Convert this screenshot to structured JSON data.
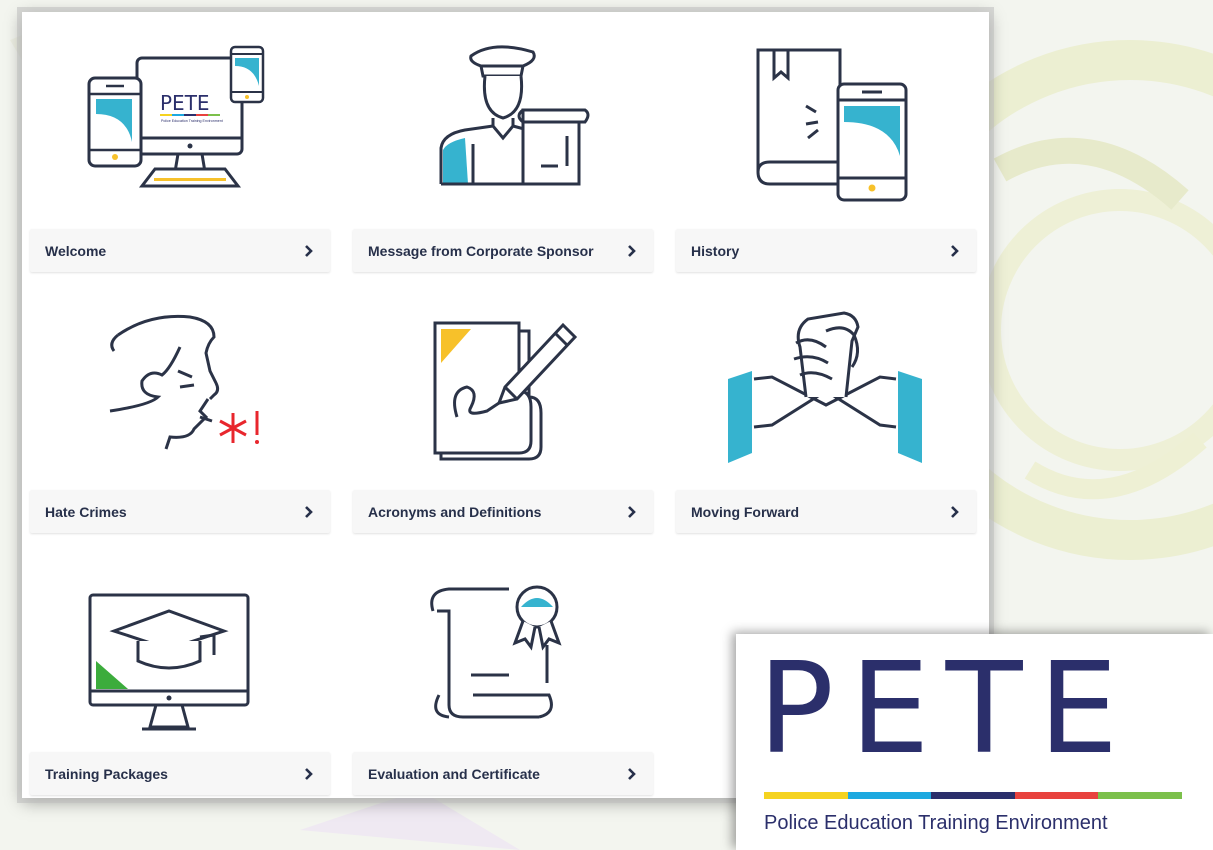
{
  "tiles": [
    {
      "label": "Welcome",
      "icon": "devices-pete-icon"
    },
    {
      "label": "Message from Corporate Sponsor",
      "icon": "officer-scroll-icon"
    },
    {
      "label": "History",
      "icon": "book-phone-icon"
    },
    {
      "label": "Hate Crimes",
      "icon": "shouting-face-icon"
    },
    {
      "label": "Acronyms and Definitions",
      "icon": "document-pencil-icon"
    },
    {
      "label": "Moving Forward",
      "icon": "handshake-icon"
    },
    {
      "label": "Training Packages",
      "icon": "monitor-graduation-cap-icon"
    },
    {
      "label": "Evaluation and Certificate",
      "icon": "certificate-scroll-icon"
    }
  ],
  "mini_logo": {
    "word": "PETE",
    "subtitle": "Police Education Training Environment"
  },
  "logo": {
    "word": "PETE",
    "subtitle": "Police Education Training Environment",
    "stripe_colors": [
      "#f5d320",
      "#1da9e0",
      "#2b2f6b",
      "#e8423e",
      "#7cc04b"
    ]
  },
  "colors": {
    "navy": "#2b3347",
    "teal": "#36b3cf",
    "yellow": "#f7c12a",
    "green": "#3cac3c",
    "red": "#e8262d",
    "background_motif": "#e9eccc"
  }
}
